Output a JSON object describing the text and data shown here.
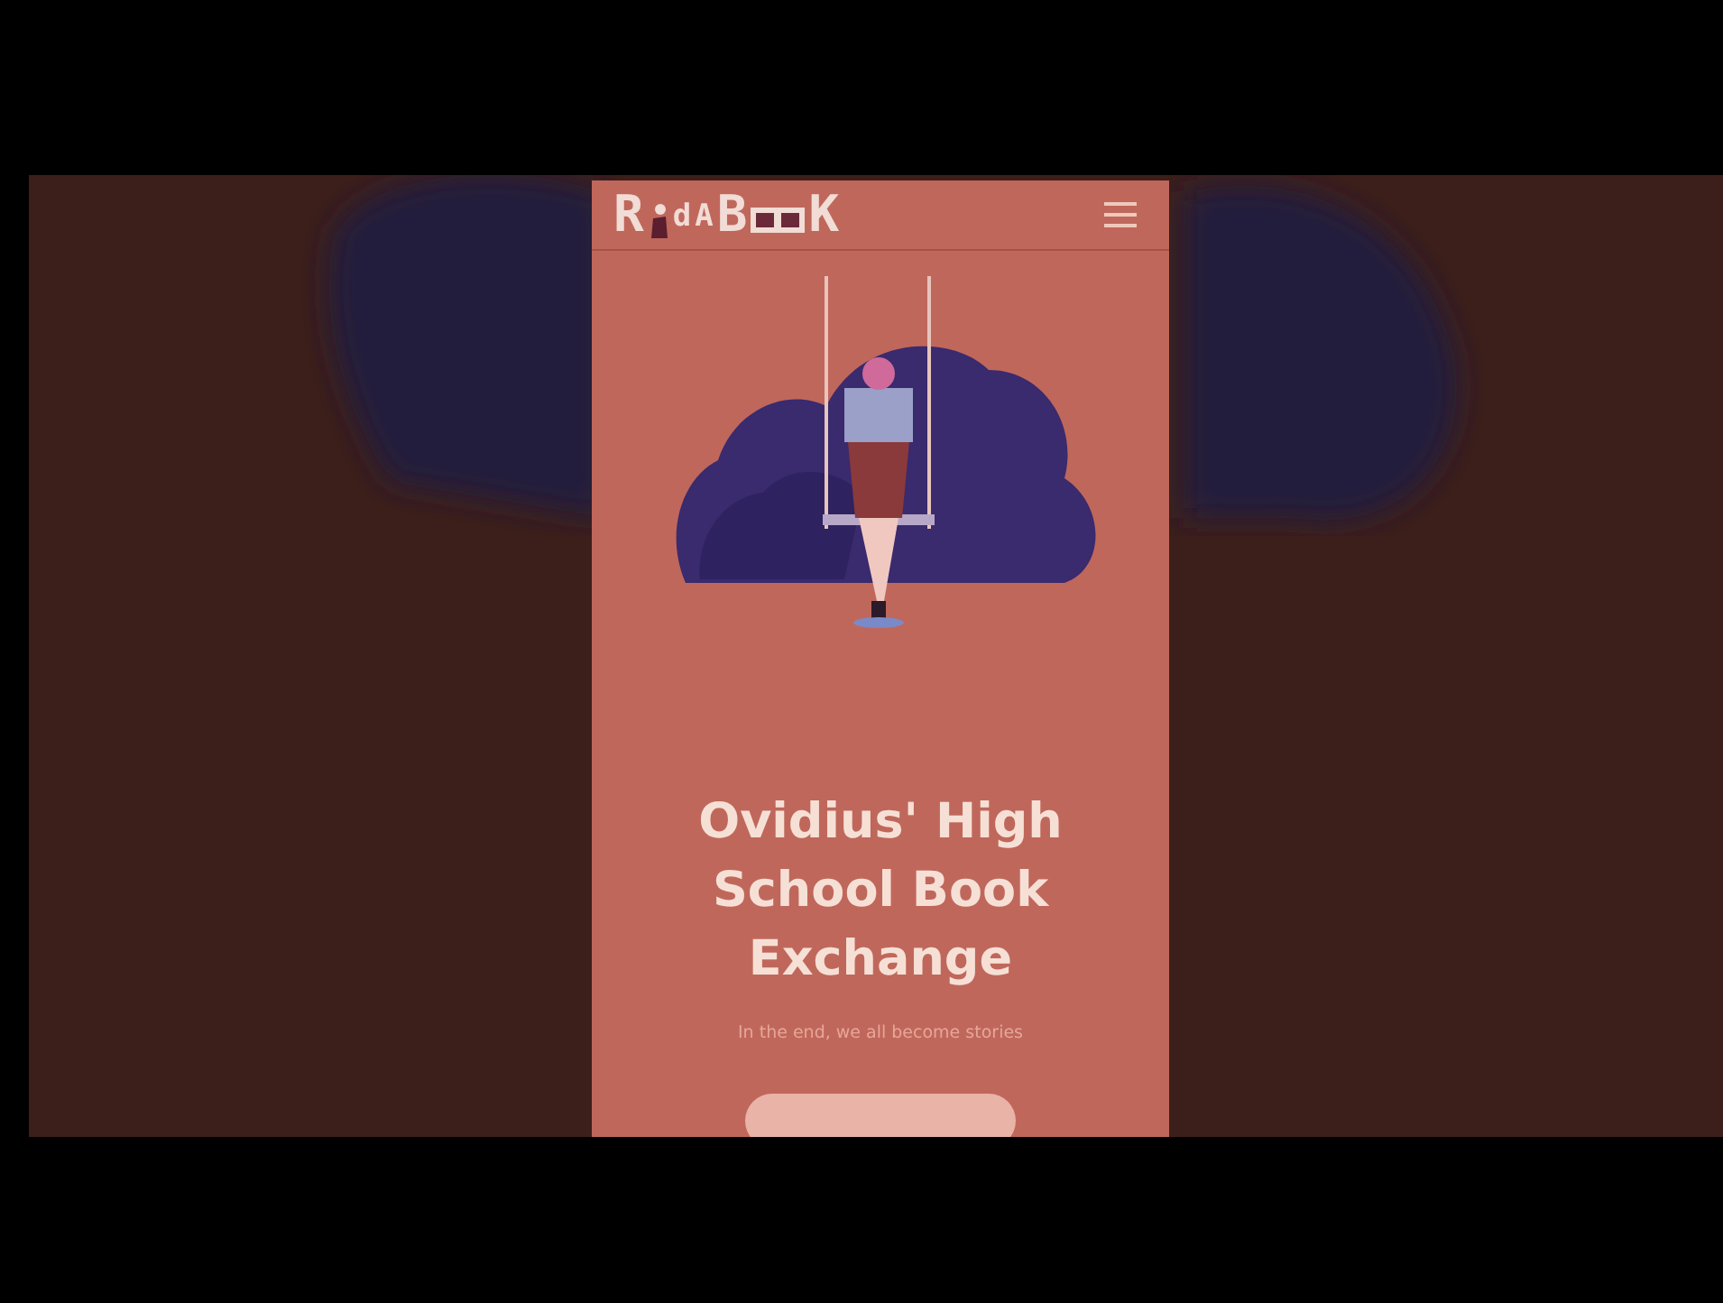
{
  "header": {
    "logo": [
      {
        "kind": "letter",
        "text": "R"
      },
      {
        "kind": "icon"
      },
      {
        "kind": "letter",
        "text": "d"
      },
      {
        "kind": "letter",
        "text": "A"
      },
      {
        "kind": "letter",
        "text": "B"
      },
      {
        "kind": "book"
      },
      {
        "kind": "letter",
        "text": "K"
      }
    ],
    "menu_icon": true
  },
  "hero": {
    "title": "Ovidius' High School Book Exchange",
    "subtitle": "In the end, we all become stories",
    "button": true
  }
}
